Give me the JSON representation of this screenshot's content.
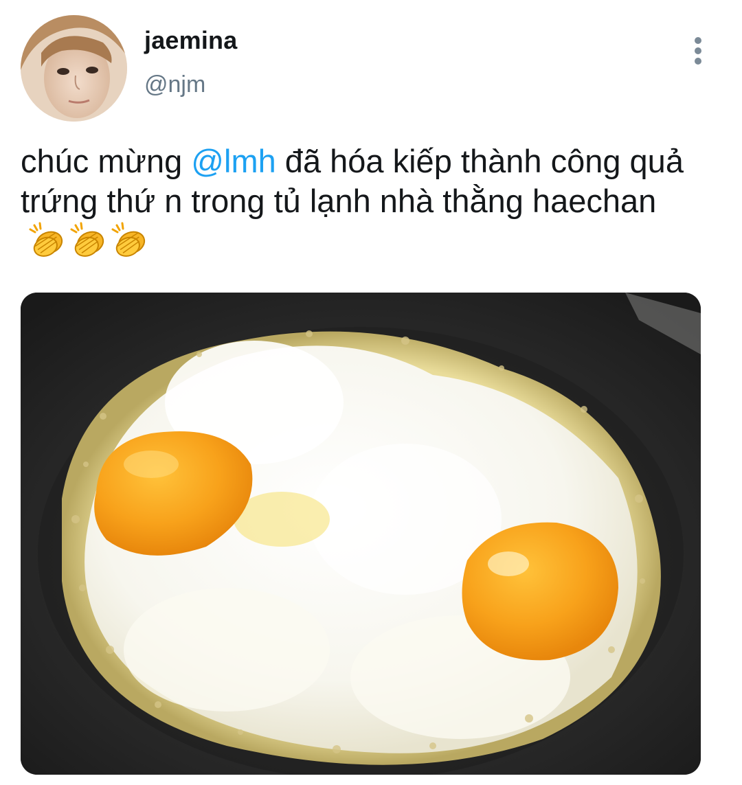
{
  "tweet": {
    "author": {
      "display_name": "jaemina",
      "handle": "@njm"
    },
    "text": {
      "part1": "chúc mừng ",
      "mention": "@lmh",
      "part2": " đã hóa kiếp thành công quả trứng thứ n trong tủ lạnh nhà thằng haechan"
    },
    "emoji": [
      "clapping-hands-emoji",
      "clapping-hands-emoji",
      "clapping-hands-emoji"
    ],
    "media": {
      "description_icon": "fried-eggs-photo"
    },
    "menu_icon": "more-vertical-icon"
  },
  "colors": {
    "text": "#14171a",
    "secondary_text": "#657786",
    "mention": "#1da1f2",
    "menu_dots": "#7b8a97"
  }
}
